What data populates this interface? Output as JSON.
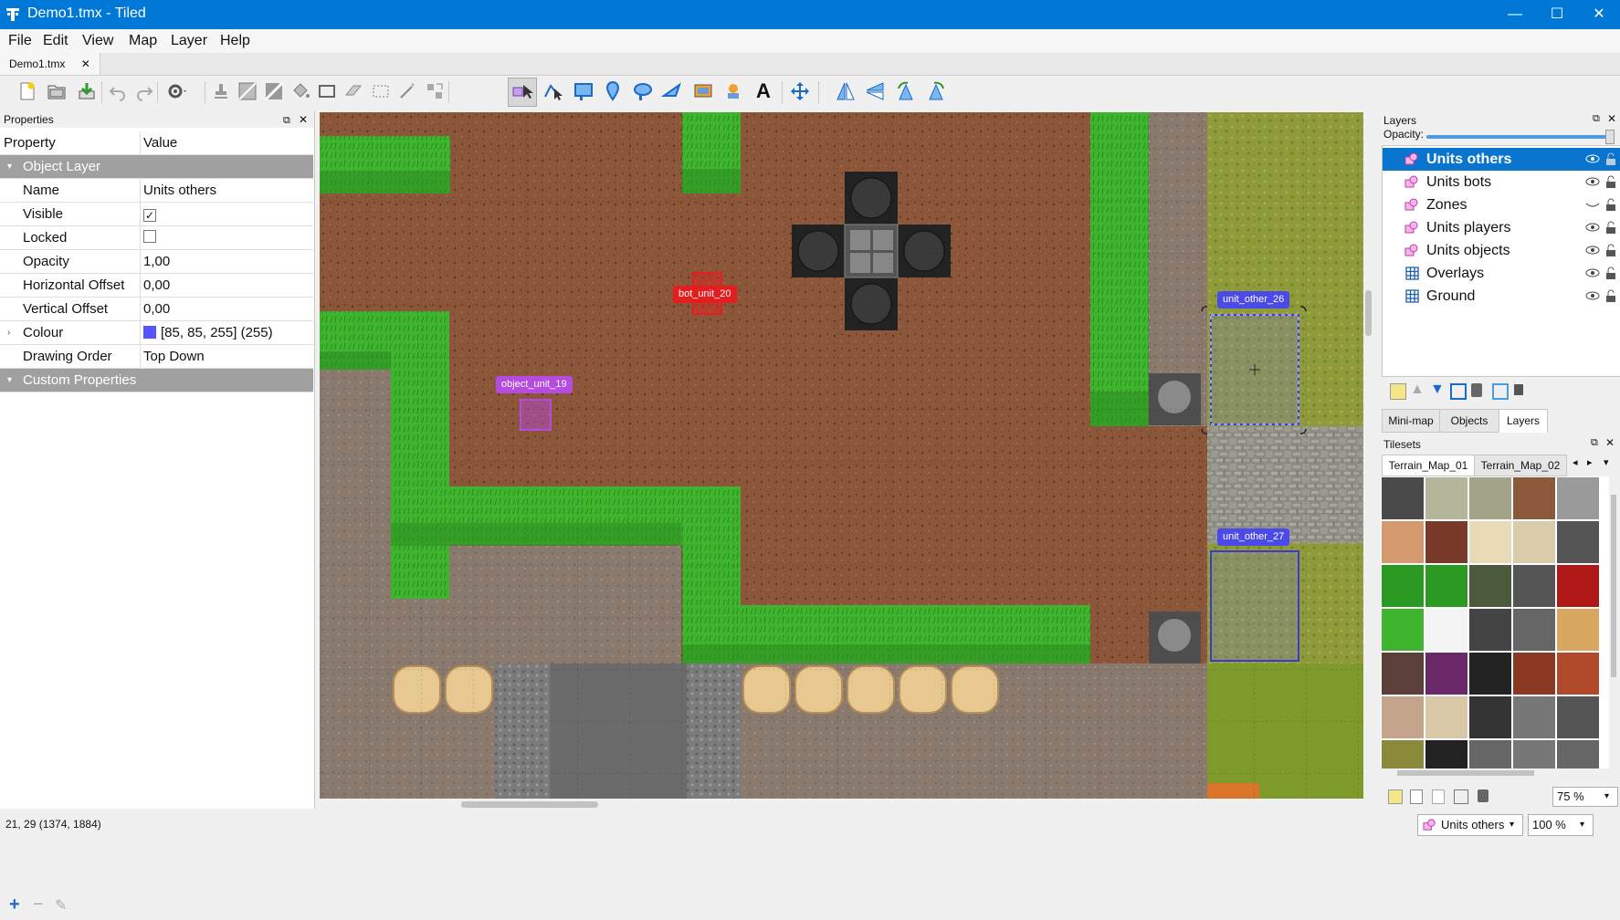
{
  "window": {
    "title": "Demo1.tmx - Tiled",
    "minimize": "—",
    "maximize": "☐",
    "close": "✕"
  },
  "menu": [
    "File",
    "Edit",
    "View",
    "Map",
    "Layer",
    "Help"
  ],
  "document_tab": {
    "label": "Demo1.tmx",
    "close": "✕"
  },
  "toolbar": {
    "icons": [
      "new-map-icon",
      "open-file-icon",
      "save-icon",
      "undo-icon",
      "redo-icon",
      "commands-icon",
      "stamp-brush-icon",
      "terrain-brush-icon",
      "wang-brush-icon",
      "bucket-fill-icon",
      "shape-fill-icon",
      "eraser-icon",
      "rectangular-select-icon",
      "magic-wand-icon",
      "select-same-tile-icon",
      "select-objects-icon",
      "edit-polygons-icon",
      "insert-rectangle-icon",
      "insert-point-icon",
      "insert-ellipse-icon",
      "insert-polygon-icon",
      "insert-tile-icon",
      "insert-template-icon",
      "insert-text-icon",
      "move-icon",
      "flip-horizontal-icon",
      "flip-vertical-icon",
      "rotate-left-icon",
      "rotate-right-icon"
    ]
  },
  "properties": {
    "title": "Properties",
    "columns": {
      "property": "Property",
      "value": "Value"
    },
    "group_object_layer": "Object Layer",
    "rows": [
      {
        "key": "Name",
        "value": "Units others"
      },
      {
        "key": "Visible",
        "value": "✓"
      },
      {
        "key": "Locked",
        "value": ""
      },
      {
        "key": "Opacity",
        "value": "1,00"
      },
      {
        "key": "Horizontal Offset",
        "value": "0,00"
      },
      {
        "key": "Vertical Offset",
        "value": "0,00"
      },
      {
        "key": "Colour",
        "value": "[85, 85, 255] (255)"
      },
      {
        "key": "Drawing Order",
        "value": "Top Down"
      }
    ],
    "group_custom": "Custom Properties",
    "colour_swatch": "#5555ff",
    "footer": {
      "add": "+",
      "remove": "−",
      "edit": "✎"
    }
  },
  "map_objects": [
    {
      "label": "bot_unit_20",
      "color": "#e41e1e"
    },
    {
      "label": "object_unit_19",
      "color": "#b74ae0"
    },
    {
      "label": "unit_other_26",
      "color": "#4a4ae8"
    },
    {
      "label": "unit_other_27",
      "color": "#4a4ae8"
    }
  ],
  "layers_panel": {
    "title": "Layers",
    "opacity_label": "Opacity:",
    "opacity_value": 1.0,
    "layers": [
      {
        "name": "Units others",
        "type": "object",
        "selected": true,
        "visible": true
      },
      {
        "name": "Units bots",
        "type": "object",
        "selected": false,
        "visible": true
      },
      {
        "name": "Zones",
        "type": "object",
        "selected": false,
        "visible": false
      },
      {
        "name": "Units players",
        "type": "object",
        "selected": false,
        "visible": true
      },
      {
        "name": "Units objects",
        "type": "object",
        "selected": false,
        "visible": true
      },
      {
        "name": "Overlays",
        "type": "tile",
        "selected": false,
        "visible": true
      },
      {
        "name": "Ground",
        "type": "tile",
        "selected": false,
        "visible": true
      }
    ],
    "selected_color": "#0a75cf"
  },
  "panel_tabs": [
    "Mini-map",
    "Objects",
    "Layers"
  ],
  "tilesets": {
    "title": "Tilesets",
    "tabs": [
      "Terrain_Map_01",
      "Terrain_Map_02"
    ],
    "zoom": "75 %"
  },
  "status": {
    "coords": "21, 29 (1374, 1884)",
    "layer_combo": "Units others",
    "zoom_combo": "100 %"
  }
}
